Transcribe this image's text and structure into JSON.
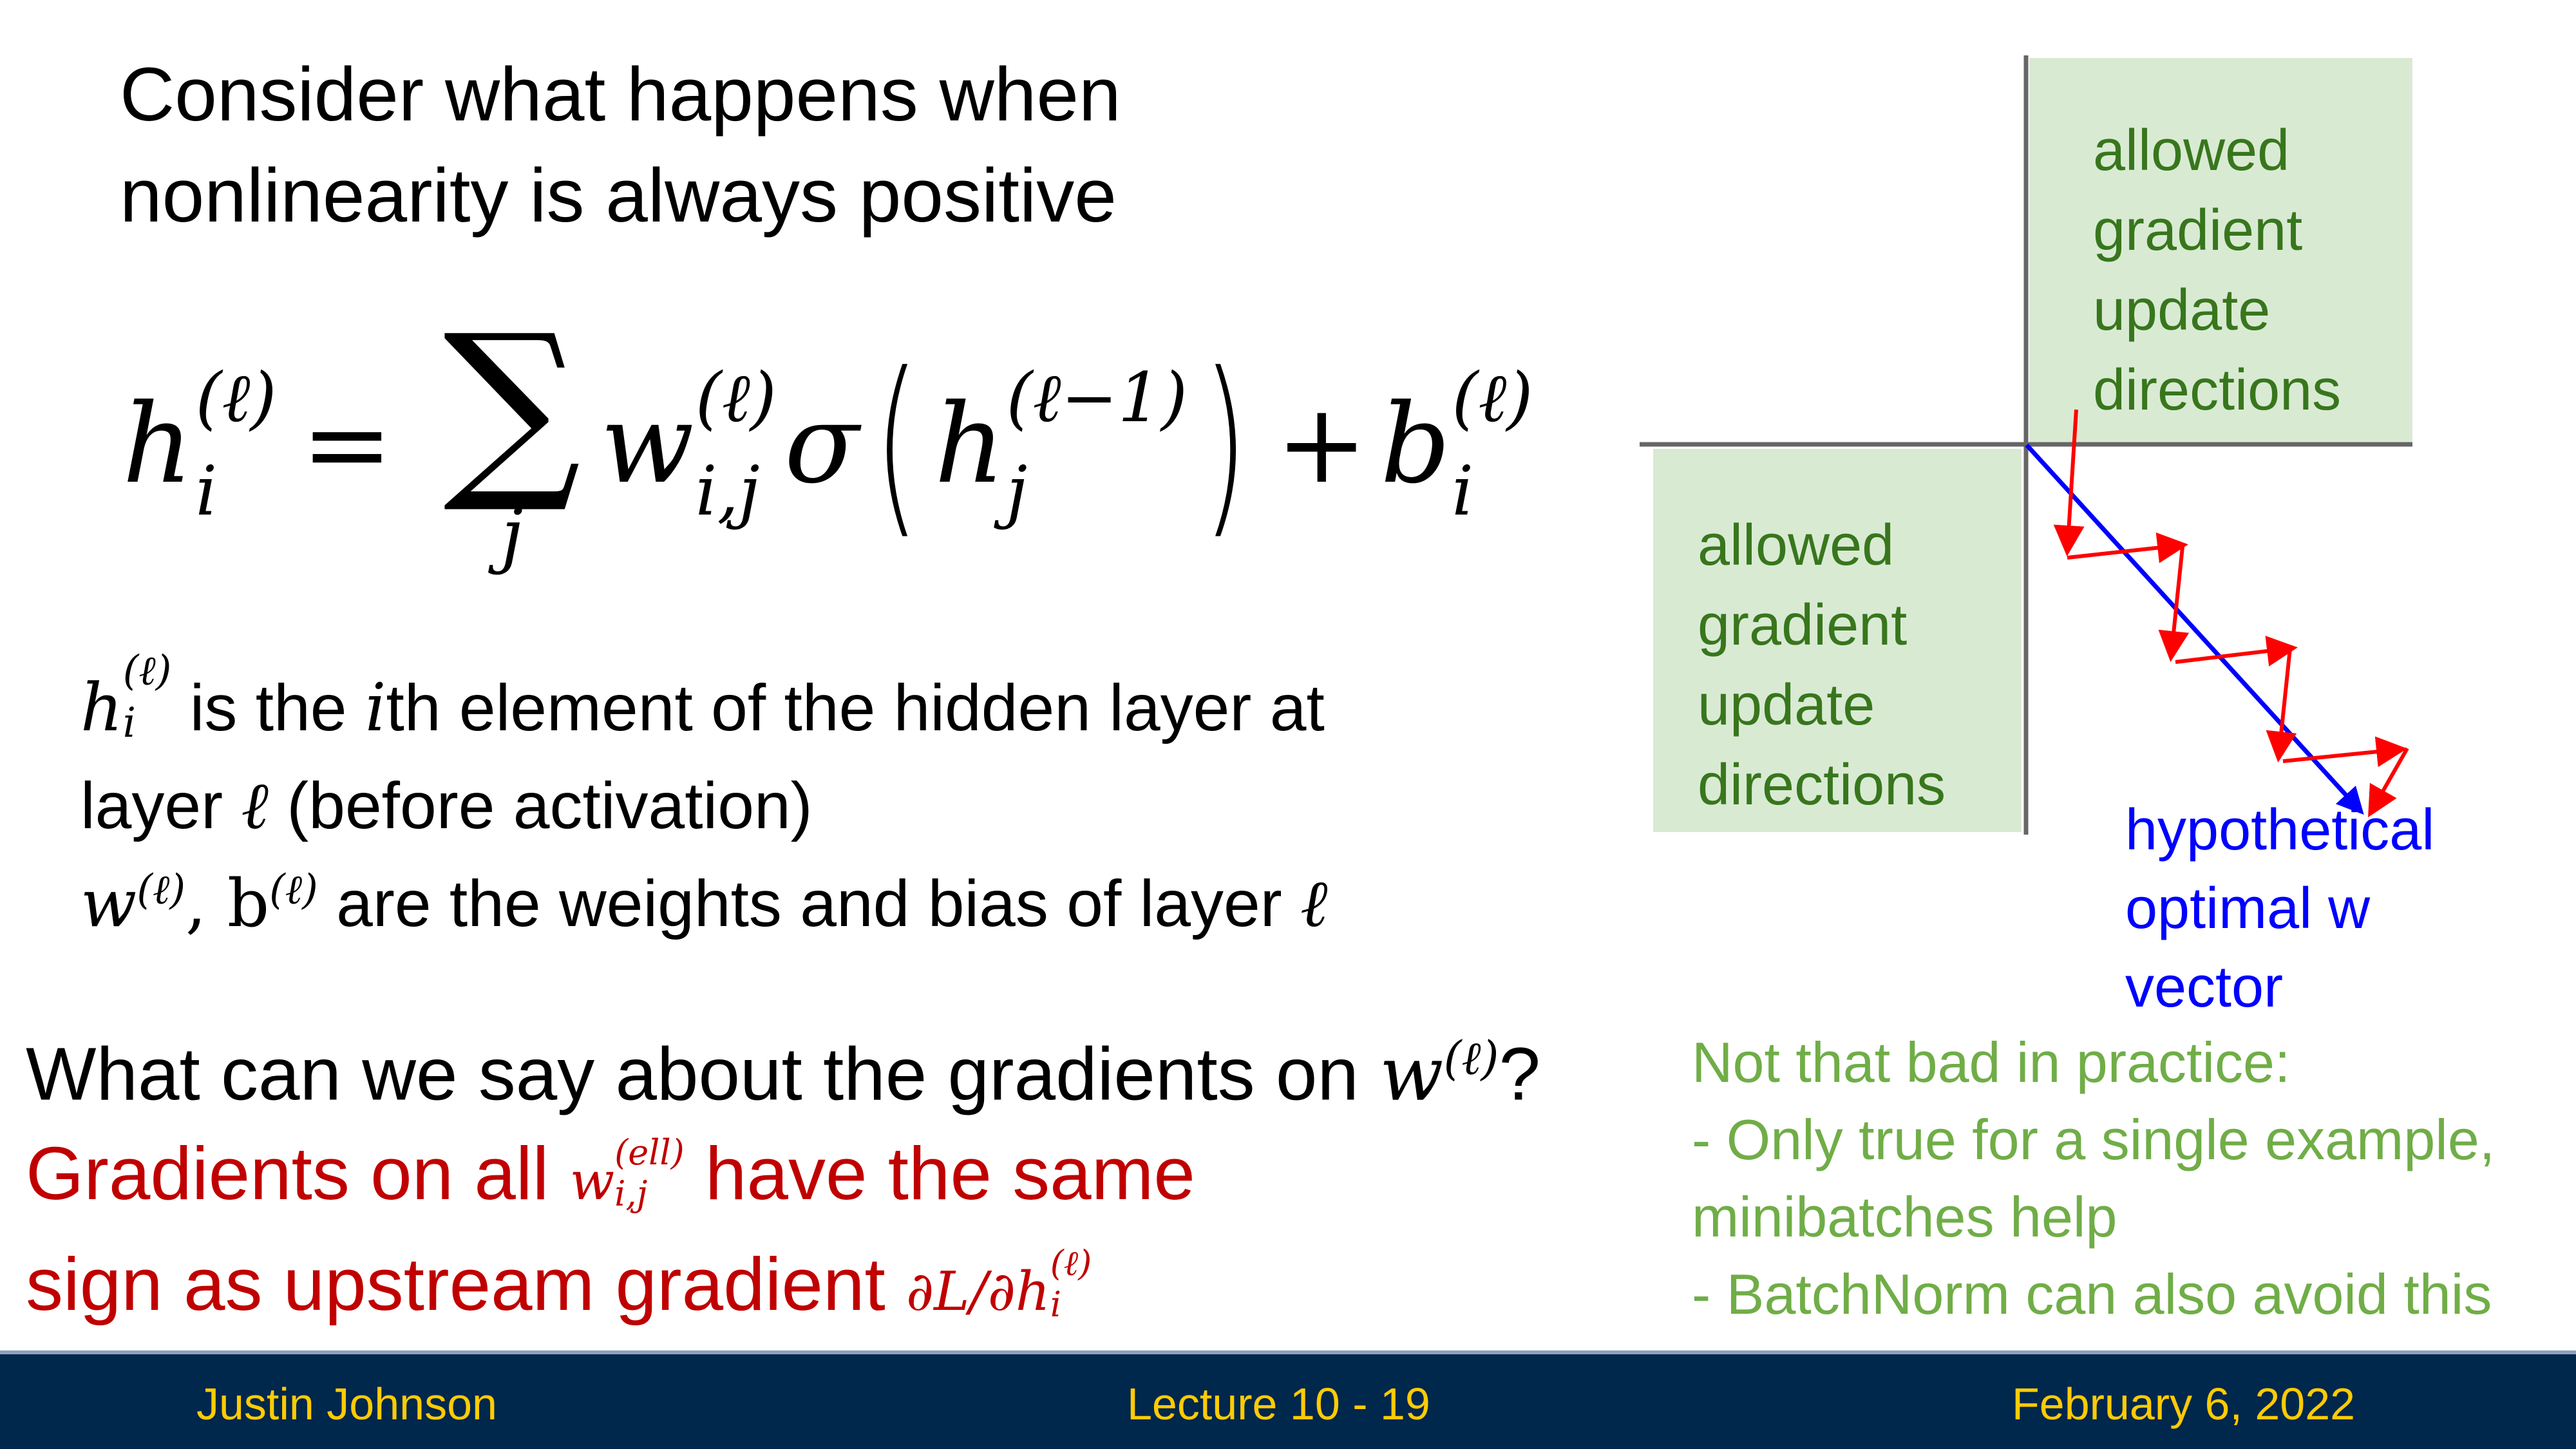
{
  "slide": {
    "title_lines": [
      "Consider what happens when",
      "nonlinearity is always positive"
    ],
    "equation": {
      "lhs_var": "h",
      "lhs_sub": "i",
      "lhs_sup": "(ℓ)",
      "equals": "=",
      "sum_symbol": "∑",
      "sum_index": "j",
      "w_var": "w",
      "w_sub": "i,j",
      "w_sup": "(ℓ)",
      "sigma": "σ",
      "open_paren": "(",
      "inner_var": "h",
      "inner_sub": "j",
      "inner_sup": "(ℓ−1)",
      "close_paren": ")",
      "plus": "+",
      "b_var": "b",
      "b_sub": "i",
      "b_sup": "(ℓ)"
    },
    "definitions": {
      "line1_var": "h",
      "line1_sub": "i",
      "line1_sup": "(ℓ)",
      "line1_text_a": " is the ",
      "line1_italic_i": "i",
      "line1_text_b": "th element of the hidden layer at",
      "line2_text": "layer ",
      "line2_ell": "ℓ",
      "line2_tail": " (before activation)",
      "line3_w": "w",
      "line3_w_sup": "(ℓ)",
      "line3_comma": ", b",
      "line3_b_sup": "(ℓ)",
      "line3_text": " are the weights and bias of layer ",
      "line3_ell": "ℓ"
    },
    "question": {
      "text": "What can we say about the gradients on ",
      "var": "w",
      "sup": "(ℓ)",
      "end": "?"
    },
    "answer": {
      "line1_a": "Gradients on all ",
      "line1_var": "w",
      "line1_sub": "i,j",
      "line1_sup": "(ell)",
      "line1_b": " have the same",
      "line2_a": "sign as upstream gradient ",
      "line2_expr": "∂L/∂h",
      "line2_sub": "i",
      "line2_sup": "(ℓ)"
    },
    "diagram": {
      "top_right_box_lines": [
        "allowed",
        "gradient",
        "update",
        "directions"
      ],
      "bottom_left_box_lines": [
        "allowed",
        "gradient",
        "update",
        "directions"
      ],
      "optimal_label_lines": [
        "hypothetical",
        "optimal w",
        "vector"
      ],
      "colors": {
        "box_fill": "#D9EAD3",
        "box_text": "#38761D",
        "axis": "#666666",
        "optimal_vector": "#0000FF",
        "gradient_steps": "#FF0000"
      }
    },
    "note": {
      "lines": [
        "Not that bad in practice:",
        "- Only true for a single example,",
        "minibatches help",
        "- BatchNorm can also avoid this"
      ]
    },
    "colors": {
      "answer_red": "#C00000",
      "note_green": "#70AD47",
      "footer_bg": "#00274C",
      "footer_text": "#FFCB05"
    }
  },
  "footer": {
    "author": "Justin Johnson",
    "lecture": "Lecture 10 - 19",
    "date": "February 6, 2022"
  }
}
